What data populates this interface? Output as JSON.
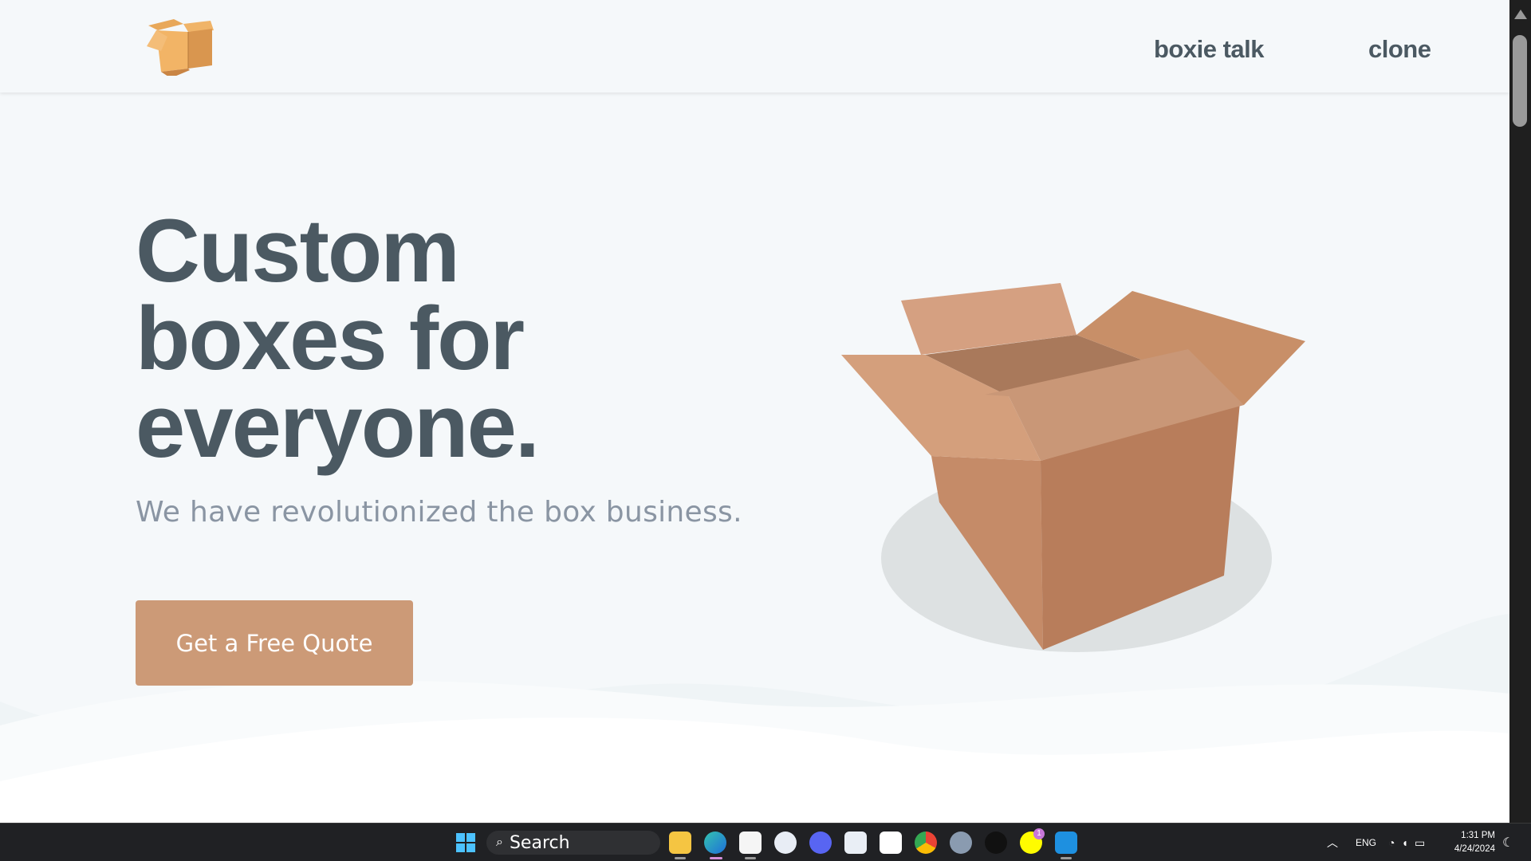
{
  "header": {
    "nav": [
      {
        "label": "boxie talk"
      },
      {
        "label": "clone"
      }
    ]
  },
  "hero": {
    "title_lines": [
      "Custom",
      "boxes for",
      "everyone."
    ],
    "subtitle": "We have revolutionized the box business.",
    "cta_label": "Get a Free Quote"
  },
  "taskbar": {
    "search_label": "Search",
    "apps": [
      "file-explorer",
      "edge",
      "microsoft-store",
      "app-store",
      "discord",
      "mail",
      "7zip",
      "chrome",
      "settings",
      "tiktok",
      "snapchat",
      "vscode"
    ],
    "language": "ENG",
    "time": "1:31 PM",
    "date": "4/24/2024",
    "badge_count": "1"
  },
  "colors": {
    "accent": "#cc9a77",
    "heading": "#4b5962",
    "subtext": "#8a95a3",
    "background": "#f5f8fa"
  }
}
